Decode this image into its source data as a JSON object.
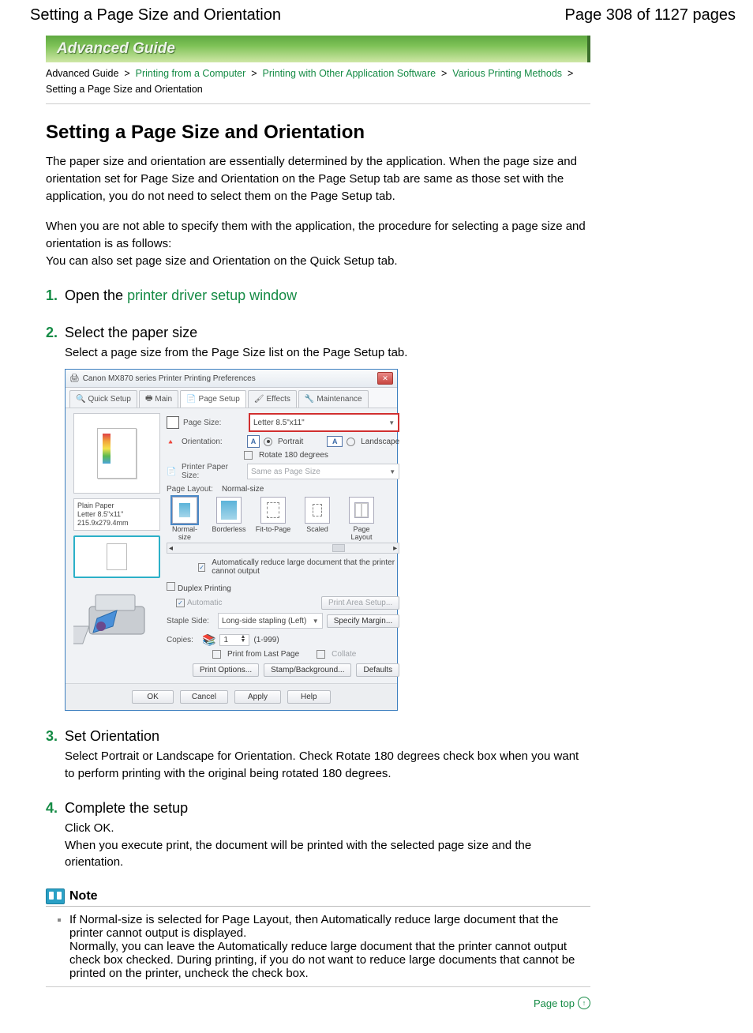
{
  "header": {
    "title_left": "Setting a Page Size and Orientation",
    "title_right": "Page 308 of 1127 pages"
  },
  "banner": "Advanced Guide",
  "breadcrumb": {
    "items": [
      "Advanced Guide",
      "Printing from a Computer",
      "Printing with Other Application Software",
      "Various Printing Methods"
    ],
    "current": "Setting a Page Size and Orientation",
    "sep": ">"
  },
  "main_title": "Setting a Page Size and Orientation",
  "intro_p1": "The paper size and orientation are essentially determined by the application. When the page size and orientation set for Page Size and Orientation on the Page Setup tab are same as those set with the application, you do not need to select them on the Page Setup tab.",
  "intro_p2": "When you are not able to specify them with the application, the procedure for selecting a page size and orientation is as follows:",
  "intro_p3": "You can also set page size and Orientation on the Quick Setup tab.",
  "steps": [
    {
      "num": "1.",
      "title_pre": "Open the ",
      "title_link": "printer driver setup window",
      "desc": ""
    },
    {
      "num": "2.",
      "title": "Select the paper size",
      "desc": "Select a page size from the Page Size list on the Page Setup tab."
    },
    {
      "num": "3.",
      "title": "Set Orientation",
      "desc": "Select Portrait or Landscape for Orientation. Check Rotate 180 degrees check box when you want to perform printing with the original being rotated 180 degrees."
    },
    {
      "num": "4.",
      "title": "Complete the setup",
      "desc": "Click OK.\nWhen you execute print, the document will be printed with the selected page size and the orientation."
    }
  ],
  "dialog": {
    "title": "Canon MX870 series Printer Printing Preferences",
    "tabs": [
      "Quick Setup",
      "Main",
      "Page Setup",
      "Effects",
      "Maintenance"
    ],
    "active_tab": 2,
    "page_size_label": "Page Size:",
    "page_size_value": "Letter 8.5\"x11\"",
    "orientation_label": "Orientation:",
    "portrait": "Portrait",
    "landscape": "Landscape",
    "rotate": "Rotate 180 degrees",
    "printer_paper_label": "Printer Paper Size:",
    "printer_paper_value": "Same as Page Size",
    "page_layout_label": "Page Layout:",
    "page_layout_value": "Normal-size",
    "layouts": [
      "Normal-size",
      "Borderless",
      "Fit-to-Page",
      "Scaled",
      "Page Layout"
    ],
    "auto_reduce": "Automatically reduce large document that the printer cannot output",
    "duplex": "Duplex Printing",
    "automatic": "Automatic",
    "print_area_btn": "Print Area Setup...",
    "staple_label": "Staple Side:",
    "staple_value": "Long-side stapling (Left)",
    "specify_margin_btn": "Specify Margin...",
    "copies_label": "Copies:",
    "copies_value": "1",
    "copies_range": "(1-999)",
    "print_last": "Print from Last Page",
    "collate": "Collate",
    "print_options_btn": "Print Options...",
    "stamp_btn": "Stamp/Background...",
    "defaults_btn": "Defaults",
    "ok": "OK",
    "cancel": "Cancel",
    "apply": "Apply",
    "help": "Help",
    "paper_info_1": "Plain Paper",
    "paper_info_2": "Letter 8.5\"x11\" 215.9x279.4mm"
  },
  "note": {
    "title": "Note",
    "item": "If Normal-size is selected for Page Layout, then Automatically reduce large document that the printer cannot output is displayed.\nNormally, you can leave the Automatically reduce large document that the printer cannot output check box checked. During printing, if you do not want to reduce large documents that cannot be printed on the printer, uncheck the check box."
  },
  "page_top": "Page top"
}
